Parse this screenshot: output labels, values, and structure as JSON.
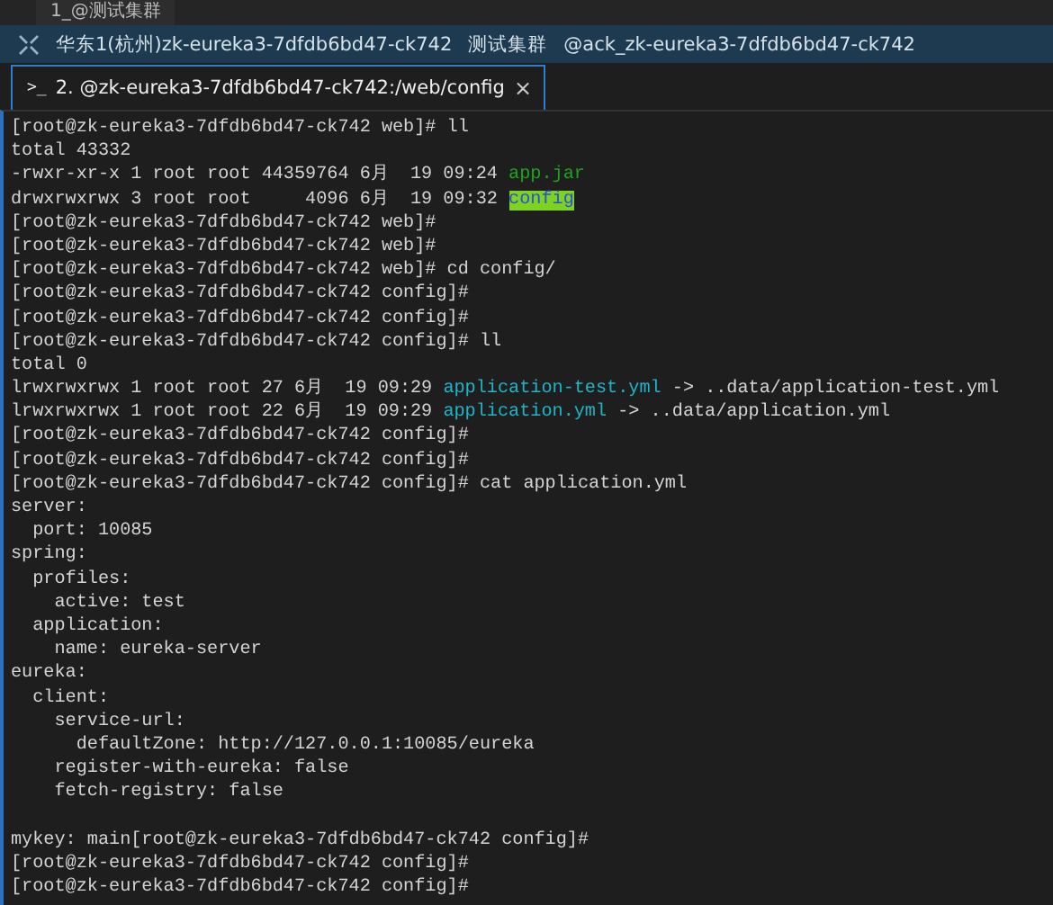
{
  "window_tab": {
    "label": "1_@测试集群"
  },
  "info_bar": {
    "items": [
      "华东1(杭州)zk-eureka3-7dfdb6bd47-ck742",
      "测试集群",
      "@ack_zk-eureka3-7dfdb6bd47-ck742"
    ]
  },
  "session_tab": {
    "prompt_glyph": ">_",
    "label": "2. @zk-eureka3-7dfdb6bd47-ck742:/web/config",
    "close": "×",
    "selected": true
  },
  "terminal": {
    "lines": [
      {
        "segments": [
          {
            "kind": "plain",
            "text": "[root@zk-eureka3-7dfdb6bd47-ck742 web]# ll"
          }
        ]
      },
      {
        "segments": [
          {
            "kind": "plain",
            "text": "total 43332"
          }
        ]
      },
      {
        "segments": [
          {
            "kind": "plain",
            "text": "-rwxr-xr-x 1 root root 44359764 6月  19 09:24 "
          },
          {
            "kind": "executable",
            "text": "app.jar"
          }
        ]
      },
      {
        "segments": [
          {
            "kind": "plain",
            "text": "drwxrwxrwx 3 root root     4096 6月  19 09:32 "
          },
          {
            "kind": "directory",
            "text": "config"
          }
        ]
      },
      {
        "segments": [
          {
            "kind": "plain",
            "text": "[root@zk-eureka3-7dfdb6bd47-ck742 web]#"
          }
        ]
      },
      {
        "segments": [
          {
            "kind": "plain",
            "text": "[root@zk-eureka3-7dfdb6bd47-ck742 web]#"
          }
        ]
      },
      {
        "segments": [
          {
            "kind": "plain",
            "text": "[root@zk-eureka3-7dfdb6bd47-ck742 web]# cd config/"
          }
        ]
      },
      {
        "segments": [
          {
            "kind": "plain",
            "text": "[root@zk-eureka3-7dfdb6bd47-ck742 config]#"
          }
        ]
      },
      {
        "segments": [
          {
            "kind": "plain",
            "text": "[root@zk-eureka3-7dfdb6bd47-ck742 config]#"
          }
        ]
      },
      {
        "segments": [
          {
            "kind": "plain",
            "text": "[root@zk-eureka3-7dfdb6bd47-ck742 config]# ll"
          }
        ]
      },
      {
        "segments": [
          {
            "kind": "plain",
            "text": "total 0"
          }
        ]
      },
      {
        "segments": [
          {
            "kind": "plain",
            "text": "lrwxrwxrwx 1 root root 27 6月  19 09:29 "
          },
          {
            "kind": "symlink",
            "text": "application-test.yml"
          },
          {
            "kind": "plain",
            "text": " -> ..data/application-test.yml"
          }
        ]
      },
      {
        "segments": [
          {
            "kind": "plain",
            "text": "lrwxrwxrwx 1 root root 22 6月  19 09:29 "
          },
          {
            "kind": "symlink",
            "text": "application.yml"
          },
          {
            "kind": "plain",
            "text": " -> ..data/application.yml"
          }
        ]
      },
      {
        "segments": [
          {
            "kind": "plain",
            "text": "[root@zk-eureka3-7dfdb6bd47-ck742 config]#"
          }
        ]
      },
      {
        "segments": [
          {
            "kind": "plain",
            "text": "[root@zk-eureka3-7dfdb6bd47-ck742 config]#"
          }
        ]
      },
      {
        "segments": [
          {
            "kind": "plain",
            "text": "[root@zk-eureka3-7dfdb6bd47-ck742 config]# cat application.yml"
          }
        ]
      },
      {
        "segments": [
          {
            "kind": "plain",
            "text": "server:"
          }
        ]
      },
      {
        "segments": [
          {
            "kind": "plain",
            "text": "  port: 10085"
          }
        ]
      },
      {
        "segments": [
          {
            "kind": "plain",
            "text": "spring:"
          }
        ]
      },
      {
        "segments": [
          {
            "kind": "plain",
            "text": "  profiles:"
          }
        ]
      },
      {
        "segments": [
          {
            "kind": "plain",
            "text": "    active: test"
          }
        ]
      },
      {
        "segments": [
          {
            "kind": "plain",
            "text": "  application:"
          }
        ]
      },
      {
        "segments": [
          {
            "kind": "plain",
            "text": "    name: eureka-server"
          }
        ]
      },
      {
        "segments": [
          {
            "kind": "plain",
            "text": "eureka:"
          }
        ]
      },
      {
        "segments": [
          {
            "kind": "plain",
            "text": "  client:"
          }
        ]
      },
      {
        "segments": [
          {
            "kind": "plain",
            "text": "    service-url:"
          }
        ]
      },
      {
        "segments": [
          {
            "kind": "plain",
            "text": "      defaultZone: http://127.0.0.1:10085/eureka"
          }
        ]
      },
      {
        "segments": [
          {
            "kind": "plain",
            "text": "    register-with-eureka: false"
          }
        ]
      },
      {
        "segments": [
          {
            "kind": "plain",
            "text": "    fetch-registry: false"
          }
        ]
      },
      {
        "gap_before": true,
        "segments": [
          {
            "kind": "plain",
            "text": "mykey: main[root@zk-eureka3-7dfdb6bd47-ck742 config]#"
          }
        ]
      },
      {
        "segments": [
          {
            "kind": "plain",
            "text": "[root@zk-eureka3-7dfdb6bd47-ck742 config]#"
          }
        ]
      },
      {
        "segments": [
          {
            "kind": "plain",
            "text": "[root@zk-eureka3-7dfdb6bd47-ck742 config]#"
          }
        ]
      }
    ]
  }
}
